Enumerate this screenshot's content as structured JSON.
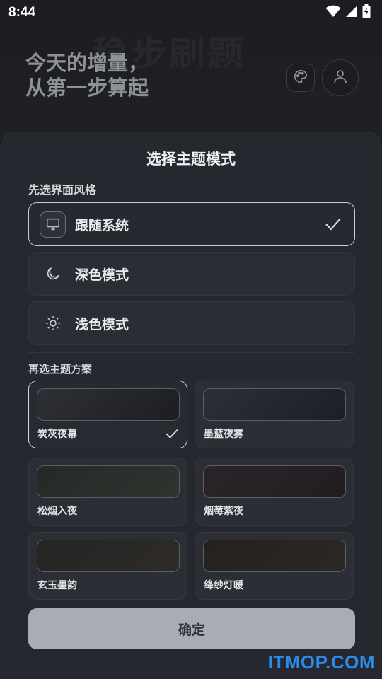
{
  "status_bar": {
    "time": "8:44",
    "icons": [
      "wifi-icon",
      "cell-signal-icon",
      "battery-charging-icon"
    ]
  },
  "header": {
    "title_line1": "今天的增量，",
    "title_line2": "从第一步算起",
    "background_watermark_text": "稳步刷题",
    "buttons": [
      "palette-icon",
      "user-icon"
    ]
  },
  "sheet": {
    "title": "选择主题模式",
    "style_section_label": "先选界面风格",
    "modes": [
      {
        "label": "跟随系统",
        "icon": "monitor-icon",
        "selected": true
      },
      {
        "label": "深色模式",
        "icon": "moon-icon",
        "selected": false
      },
      {
        "label": "浅色模式",
        "icon": "sun-icon",
        "selected": false
      }
    ],
    "scheme_section_label": "再选主题方案",
    "themes": [
      {
        "name": "炭灰夜幕",
        "selected": true,
        "gradient": [
          "#2e3035",
          "#1d1e22"
        ]
      },
      {
        "name": "墨蓝夜雾",
        "selected": false,
        "gradient": [
          "#2c2f36",
          "#1c1f25"
        ]
      },
      {
        "name": "松烟入夜",
        "selected": false,
        "gradient": [
          "#242a26",
          "#2f342f"
        ]
      },
      {
        "name": "烟莓紫夜",
        "selected": false,
        "gradient": [
          "#2b2529",
          "#211d21"
        ]
      },
      {
        "name": "玄玉墨韵",
        "selected": false,
        "gradient": [
          "#252525",
          "#2e2b27"
        ]
      },
      {
        "name": "绛纱灯暖",
        "selected": false,
        "gradient": [
          "#24211f",
          "#2c2825"
        ]
      }
    ],
    "confirm_label": "确定"
  },
  "watermark": "ITMOP.COM",
  "colors": {
    "sheet_bg": "#25282e",
    "selected_border": "#c9ccd2",
    "confirm_bg": "#a8acb3",
    "watermark_blue": "#2a8ce8"
  }
}
